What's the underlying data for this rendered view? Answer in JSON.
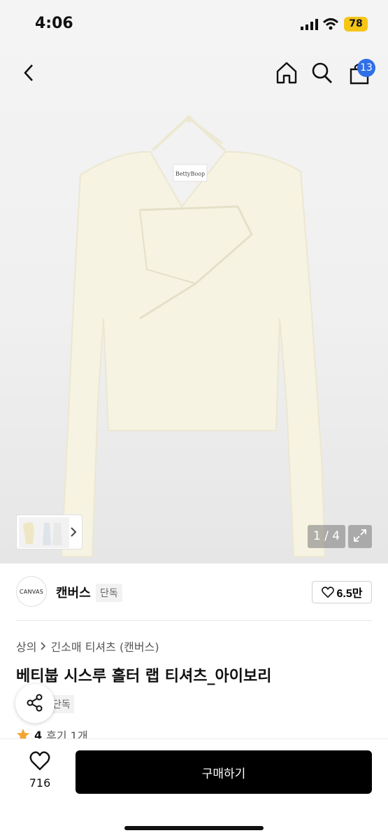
{
  "status_bar": {
    "time": "4:06",
    "battery": "78"
  },
  "nav": {
    "cart_count": "13"
  },
  "gallery": {
    "counter": "1 / 4"
  },
  "brand": {
    "logo_text": "CANVAS",
    "name": "캔버스",
    "tag": "단독",
    "likes": "6.5만"
  },
  "breadcrumb": {
    "root": "상의",
    "category": "긴소매 티셔츠 (캔버스)"
  },
  "product": {
    "title": "베티붑 시스루 홀터 랩 티셔츠_아이보리",
    "exclusive_tag": "단독",
    "rating": "4",
    "reviews": "후기 1개"
  },
  "bottom": {
    "wish_count": "716",
    "buy_label": "구매하기"
  },
  "colors": {
    "accent": "#2f6fe8",
    "buy_button": "#000000",
    "battery": "#f5c518",
    "star": "#f2a531",
    "garment": "#f6f3e2"
  },
  "icons": [
    "back-icon",
    "home-icon",
    "search-icon",
    "cart-icon",
    "expand-icon",
    "heart-icon",
    "share-icon",
    "star-icon",
    "chevron-right-icon"
  ]
}
